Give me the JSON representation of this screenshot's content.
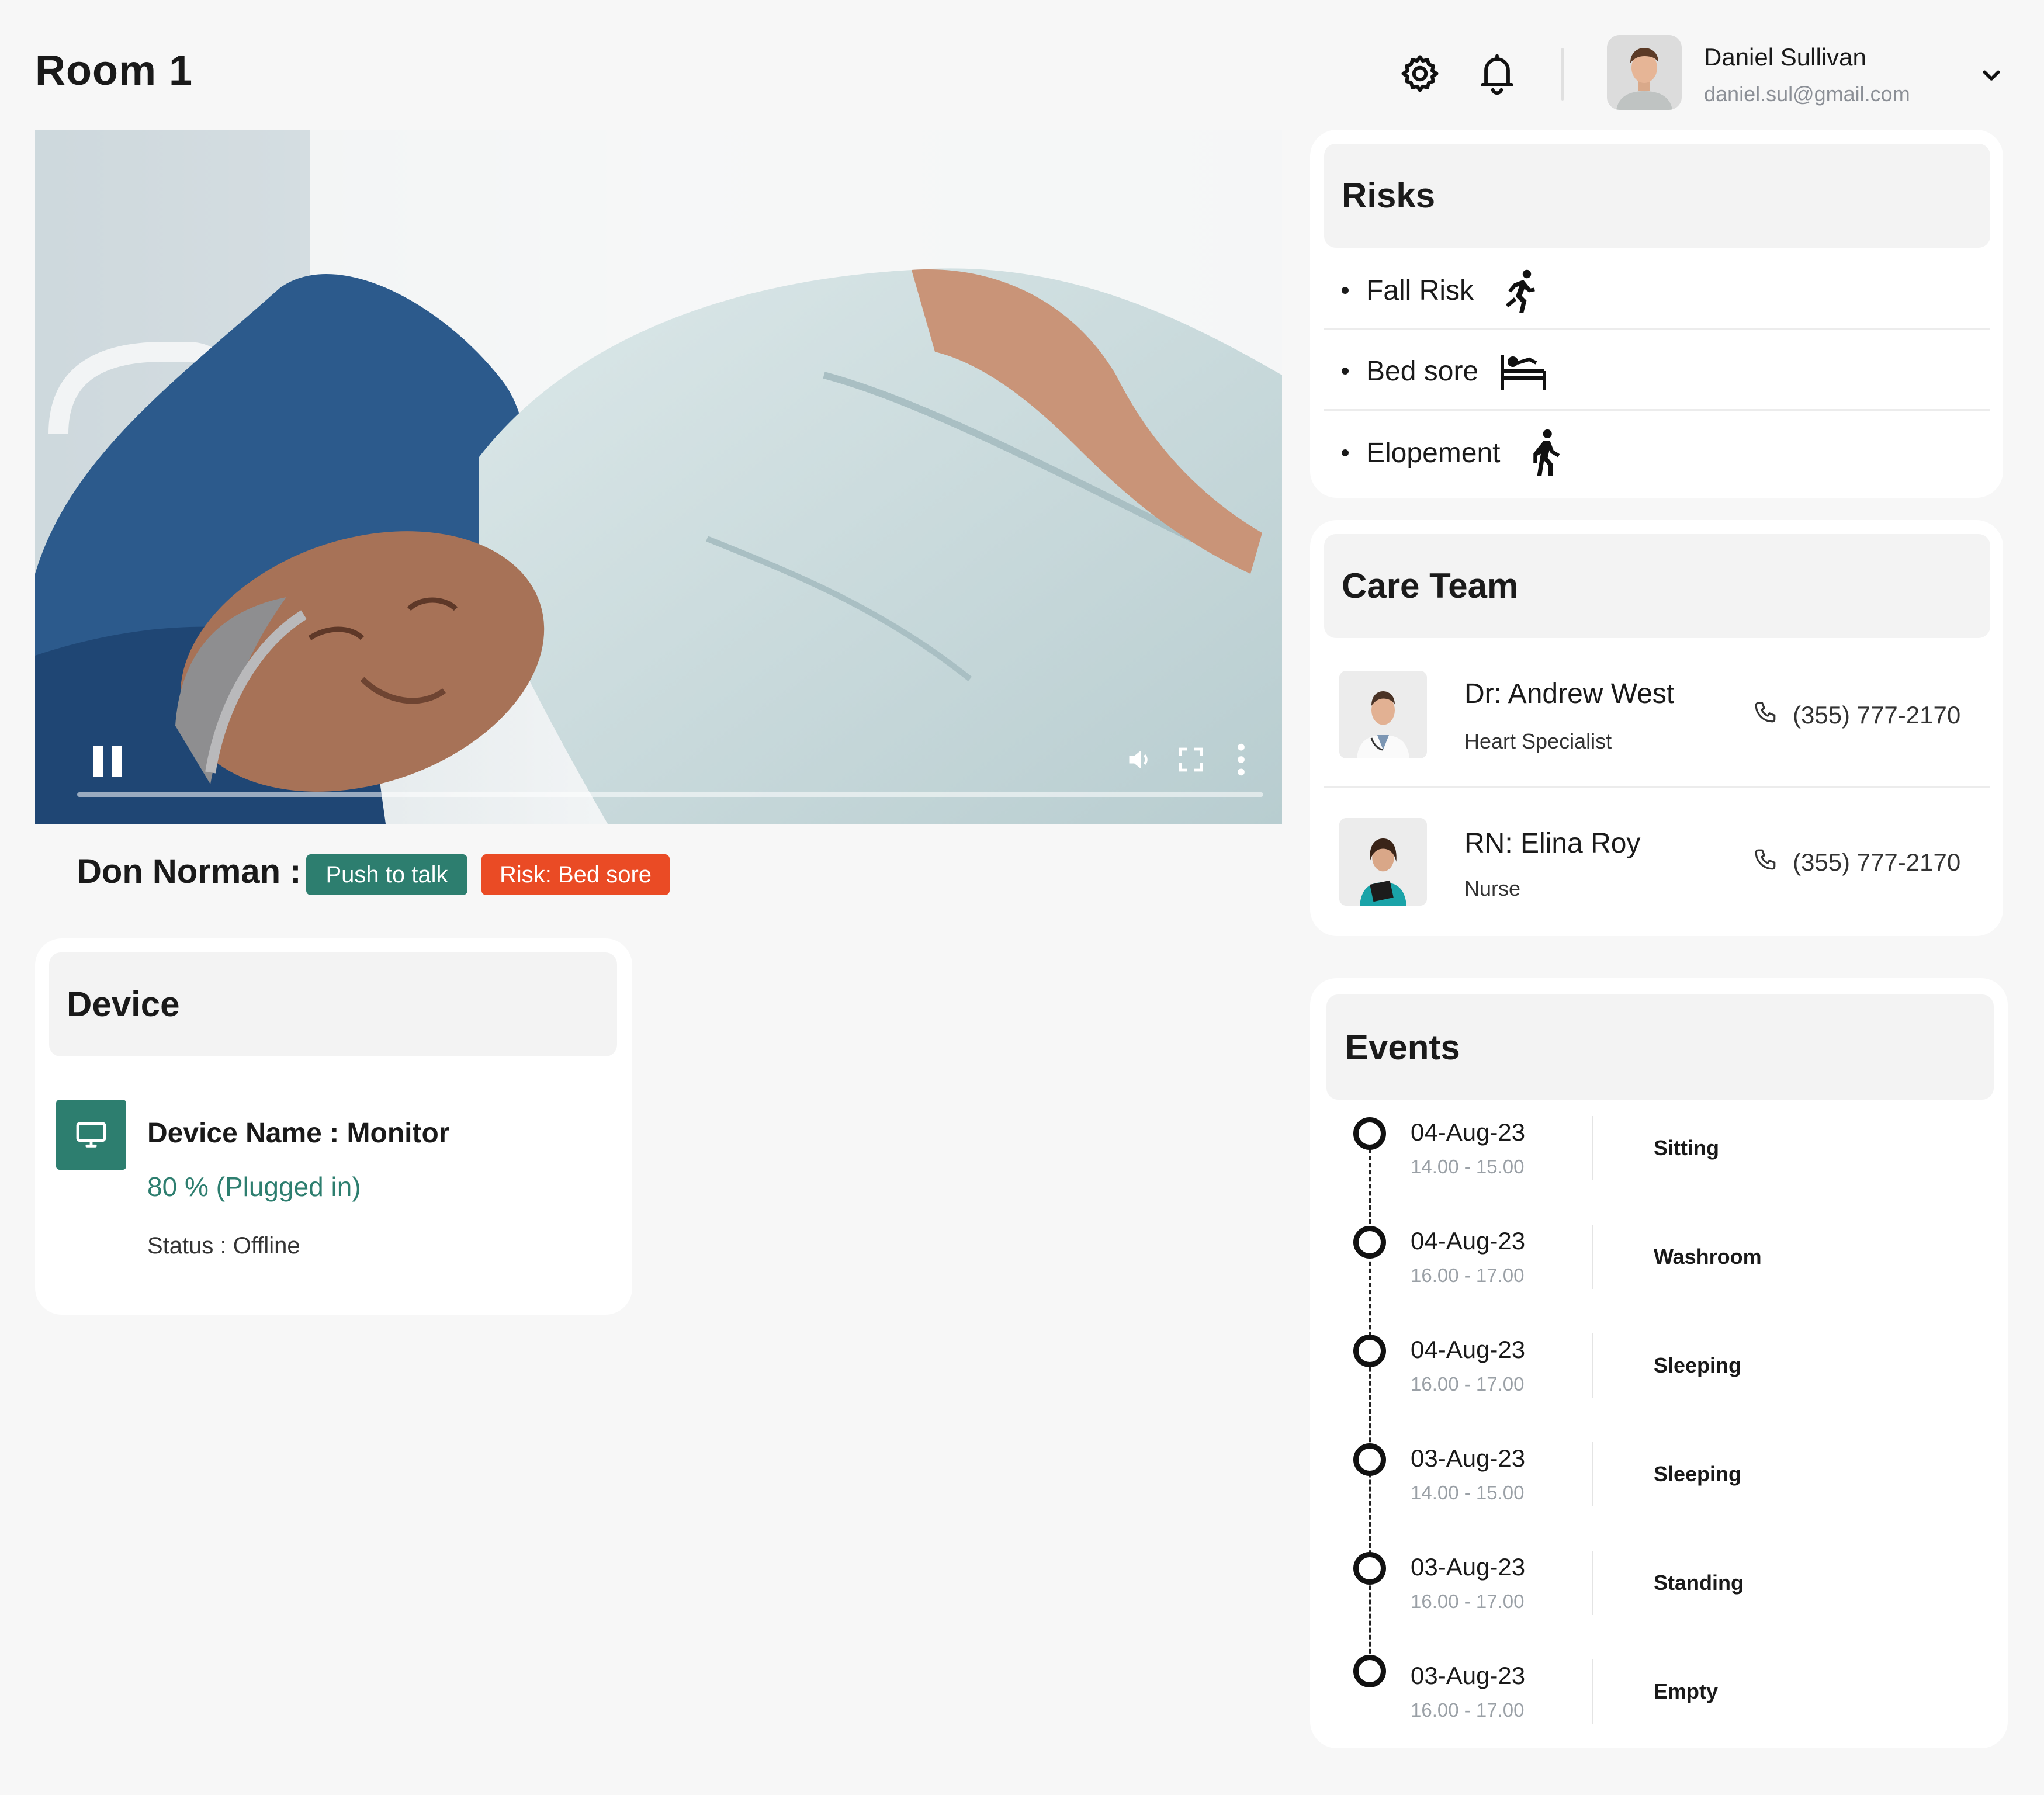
{
  "header": {
    "title": "Room 1",
    "user": {
      "name": "Daniel Sullivan",
      "email": "daniel.sul@gmail.com"
    }
  },
  "video": {
    "state": "playing"
  },
  "patient": {
    "name": "Don Norman :",
    "talk_label": "Push to talk",
    "risk_label": "Risk: Bed sore"
  },
  "device": {
    "title": "Device",
    "name": "Device Name : Monitor",
    "battery": "80 % (Plugged in)",
    "status": "Status : Offline"
  },
  "risks": {
    "title": "Risks",
    "items": [
      {
        "label": "Fall Risk",
        "icon": "fall-icon"
      },
      {
        "label": "Bed sore",
        "icon": "bed-icon"
      },
      {
        "label": "Elopement",
        "icon": "walking-icon"
      }
    ]
  },
  "care_team": {
    "title": "Care Team",
    "members": [
      {
        "name": "Dr: Andrew West",
        "role": "Heart Specialist",
        "phone": "(355) 777-2170"
      },
      {
        "name": "RN: Elina Roy",
        "role": "Nurse",
        "phone": "(355) 777-2170"
      }
    ]
  },
  "events": {
    "title": "Events",
    "items": [
      {
        "date": "04-Aug-23",
        "time": "14.00 - 15.00",
        "activity": "Sitting"
      },
      {
        "date": "04-Aug-23",
        "time": "16.00 - 17.00",
        "activity": "Washroom"
      },
      {
        "date": "04-Aug-23",
        "time": "16.00 - 17.00",
        "activity": "Sleeping"
      },
      {
        "date": "03-Aug-23",
        "time": "14.00 - 15.00",
        "activity": "Sleeping"
      },
      {
        "date": "03-Aug-23",
        "time": "16.00 - 17.00",
        "activity": "Standing"
      },
      {
        "date": "03-Aug-23",
        "time": "16.00 - 17.00",
        "activity": "Empty"
      }
    ]
  },
  "colors": {
    "accent": "#2d7e6f",
    "danger": "#ea4b25",
    "background": "#f7f7f7"
  }
}
